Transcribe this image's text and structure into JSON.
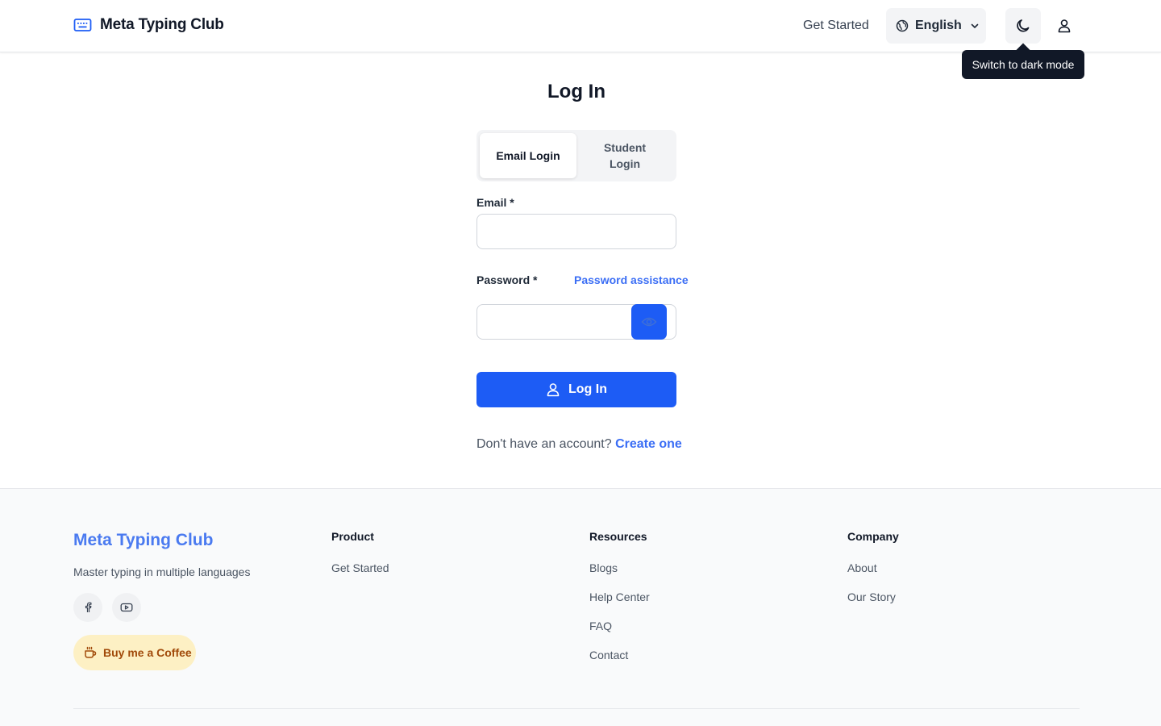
{
  "header": {
    "brand": "Meta Typing Club",
    "nav_get_started": "Get Started",
    "language": "English",
    "theme_tooltip": "Switch to dark mode"
  },
  "main": {
    "title": "Log In",
    "tabs": [
      {
        "label": "Email Login",
        "active": true
      },
      {
        "label": "Student Login",
        "active": false
      }
    ],
    "email_label": "Email *",
    "email_value": "",
    "password_label": "Password *",
    "password_assistance": "Password assistance",
    "password_value": "",
    "login_button": "Log In",
    "signup_prompt": "Don't have an account?",
    "signup_link": "Create one"
  },
  "footer": {
    "brand": "Meta Typing Club",
    "tagline": "Master typing in multiple languages",
    "social": [
      "facebook-icon",
      "youtube-icon"
    ],
    "coffee": "Buy me a Coffee",
    "columns": [
      {
        "heading": "Product",
        "links": [
          "Get Started"
        ]
      },
      {
        "heading": "Resources",
        "links": [
          "Blogs",
          "Help Center",
          "FAQ",
          "Contact"
        ]
      },
      {
        "heading": "Company",
        "links": [
          "About",
          "Our Story"
        ]
      }
    ]
  },
  "colors": {
    "accent": "#1d5cf5",
    "link": "#3b6ef5",
    "coffee_bg": "#fdf0c4",
    "coffee_text": "#a14a0a"
  }
}
